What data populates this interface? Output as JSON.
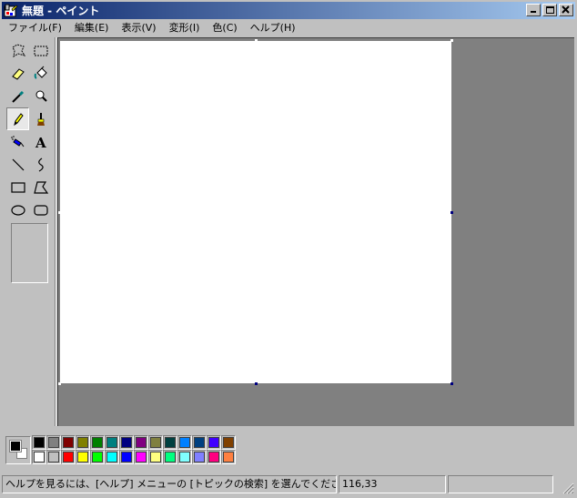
{
  "window": {
    "title": "無題 - ペイント"
  },
  "menu": [
    "ファイル(F)",
    "編集(E)",
    "表示(V)",
    "変形(I)",
    "色(C)",
    "ヘルプ(H)"
  ],
  "tools": [
    {
      "name": "free-form-select-icon"
    },
    {
      "name": "rect-select-icon"
    },
    {
      "name": "eraser-icon"
    },
    {
      "name": "fill-bucket-icon"
    },
    {
      "name": "color-picker-icon"
    },
    {
      "name": "magnifier-icon"
    },
    {
      "name": "pencil-icon",
      "selected": true
    },
    {
      "name": "brush-icon"
    },
    {
      "name": "airbrush-icon"
    },
    {
      "name": "text-icon",
      "glyph": "A"
    },
    {
      "name": "line-icon"
    },
    {
      "name": "curve-icon"
    },
    {
      "name": "rectangle-icon"
    },
    {
      "name": "polygon-icon"
    },
    {
      "name": "ellipse-icon"
    },
    {
      "name": "rounded-rect-icon"
    }
  ],
  "colors": {
    "foreground": "#000000",
    "background": "#ffffff",
    "palette_row1": [
      "#000000",
      "#808080",
      "#800000",
      "#808000",
      "#008000",
      "#008080",
      "#000080",
      "#800080",
      "#808040",
      "#004040",
      "#0080ff",
      "#004080",
      "#4000ff",
      "#804000"
    ],
    "palette_row2": [
      "#ffffff",
      "#c0c0c0",
      "#ff0000",
      "#ffff00",
      "#00ff00",
      "#00ffff",
      "#0000ff",
      "#ff00ff",
      "#ffff80",
      "#00ff80",
      "#80ffff",
      "#8080ff",
      "#ff0080",
      "#ff8040"
    ]
  },
  "status": {
    "help": "ヘルプを見るには、[ヘルプ] メニューの [トピックの検索] を選んでください。",
    "coords": "116,33",
    "size": ""
  }
}
